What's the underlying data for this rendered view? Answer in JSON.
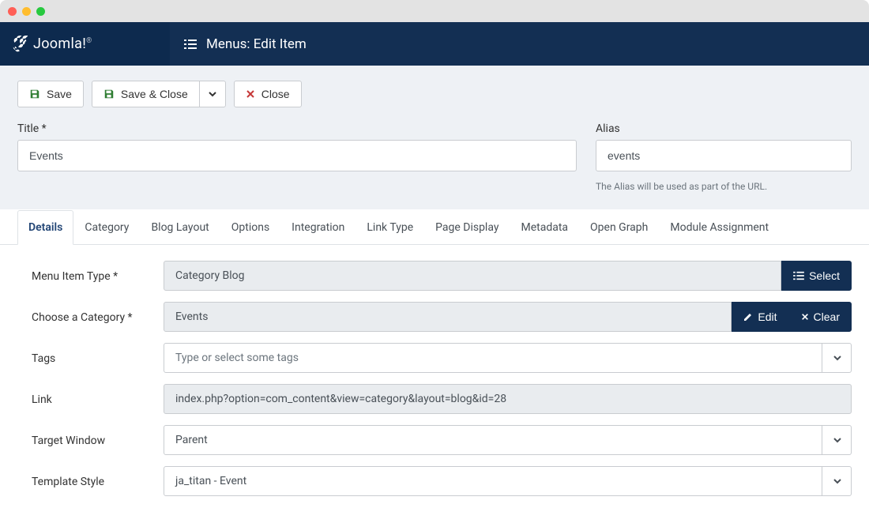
{
  "app": {
    "name": "Joomla!",
    "page_title": "Menus: Edit Item"
  },
  "toolbar": {
    "save": "Save",
    "save_close": "Save & Close",
    "close": "Close"
  },
  "title_field": {
    "label": "Title *",
    "value": "Events"
  },
  "alias_field": {
    "label": "Alias",
    "value": "events",
    "hint": "The Alias will be used as part of the URL."
  },
  "tabs": [
    "Details",
    "Category",
    "Blog Layout",
    "Options",
    "Integration",
    "Link Type",
    "Page Display",
    "Metadata",
    "Open Graph",
    "Module Assignment"
  ],
  "active_tab": 0,
  "details": {
    "menu_item_type": {
      "label": "Menu Item Type *",
      "value": "Category Blog",
      "select_btn": "Select"
    },
    "choose_category": {
      "label": "Choose a Category *",
      "value": "Events",
      "edit_btn": "Edit",
      "clear_btn": "Clear"
    },
    "tags": {
      "label": "Tags",
      "placeholder": "Type or select some tags"
    },
    "link": {
      "label": "Link",
      "value": "index.php?option=com_content&view=category&layout=blog&id=28"
    },
    "target_window": {
      "label": "Target Window",
      "value": "Parent"
    },
    "template_style": {
      "label": "Template Style",
      "value": "ja_titan - Event"
    }
  }
}
